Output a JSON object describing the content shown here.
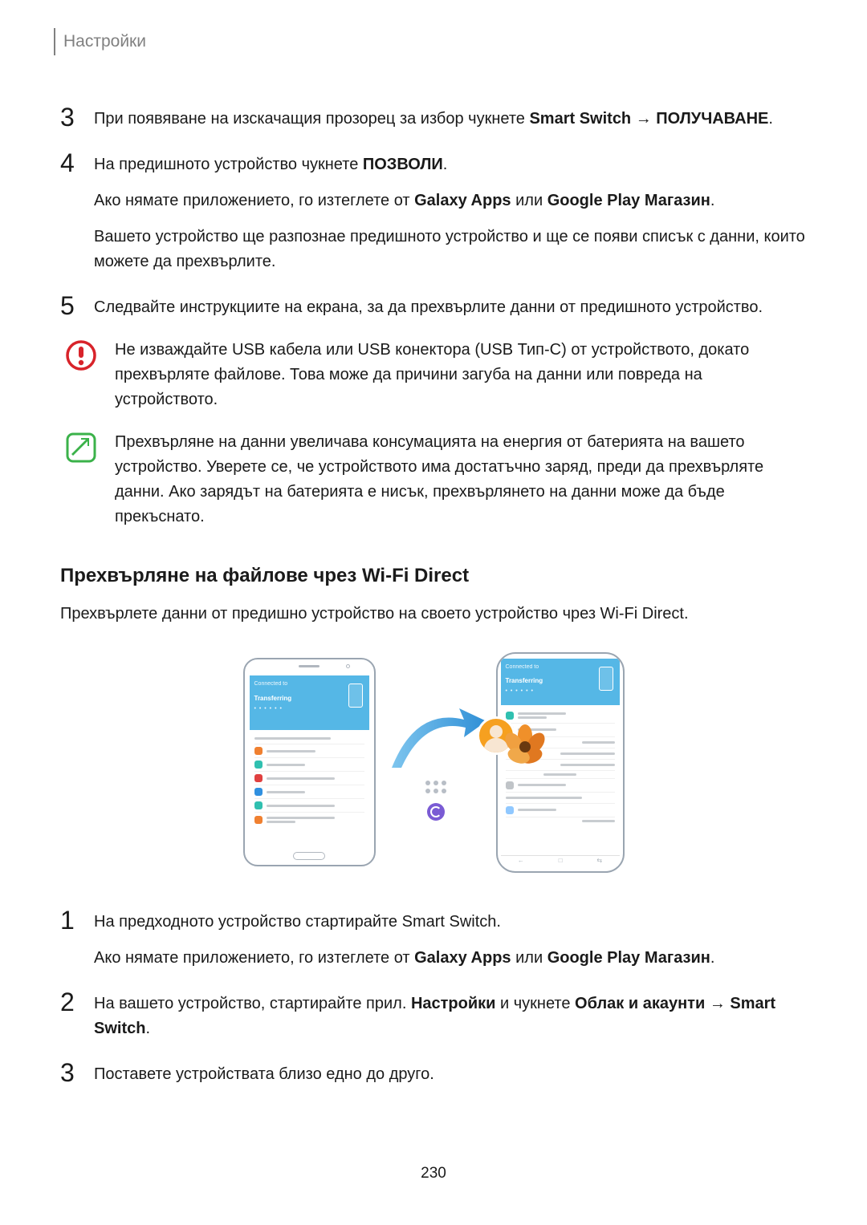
{
  "header": {
    "title": "Настройки"
  },
  "steps_top": {
    "s3": {
      "num": "3",
      "parts": {
        "a": "При появяване на изскачащия прозорец за избор чукнете ",
        "b": "Smart Switch",
        "arrow": " → ",
        "c": "ПОЛУЧАВАНЕ",
        "d": "."
      }
    },
    "s4": {
      "num": "4",
      "p1": {
        "a": "На предишното устройство чукнете ",
        "b": "ПОЗВОЛИ",
        "c": "."
      },
      "p2": {
        "a": "Ако нямате приложението, го изтеглете от ",
        "b": "Galaxy Apps",
        "c": " или ",
        "d": "Google Play Магазин",
        "e": "."
      },
      "p3": "Вашето устройство ще разпознае предишното устройство и ще се появи списък с данни, които можете да прехвърлите."
    },
    "s5": {
      "num": "5",
      "text": "Следвайте инструкциите на екрана, за да прехвърлите данни от предишното устройство."
    }
  },
  "notes": {
    "warning": "Не изваждайте USB кабела или USB конектора (USB Тип-C) от устройството, докато прехвърляте файлове. Това може да причини загуба на данни или повреда на устройството.",
    "info": "Прехвърляне на данни увеличава консумацията на енергия от батерията на вашето устройство. Уверете се, че устройството има достатъчно заряд, преди да прехвърляте данни. Ако зарядът на батерията е нисък, прехвърлянето на данни може да бъде прекъснато."
  },
  "section": {
    "heading": "Прехвърляне на файлове чрез Wi-Fi Direct",
    "intro": "Прехвърлете данни от предишно устройство на своето устройство чрез Wi-Fi Direct."
  },
  "illustration": {
    "left_hdr1": "Connected to",
    "left_hdr2": "Transferring",
    "right_hdr1": "Connected to",
    "right_hdr2": "Transferring",
    "nav_left": "←",
    "nav_mid": "□",
    "nav_right": "⇆"
  },
  "steps_bottom": {
    "s1": {
      "num": "1",
      "p1": "На предходното устройство стартирайте Smart Switch.",
      "p2": {
        "a": "Ако нямате приложението, го изтеглете от ",
        "b": "Galaxy Apps",
        "c": " или ",
        "d": "Google Play Магазин",
        "e": "."
      }
    },
    "s2": {
      "num": "2",
      "parts": {
        "a": "На вашето устройство, стартирайте прил. ",
        "b": "Настройки",
        "c": " и чукнете ",
        "d": "Облак и акаунти",
        "arrow": " → ",
        "e": "Smart Switch",
        "f": "."
      }
    },
    "s3": {
      "num": "3",
      "text": "Поставете устройствата близо едно до друго."
    }
  },
  "page_number": "230"
}
